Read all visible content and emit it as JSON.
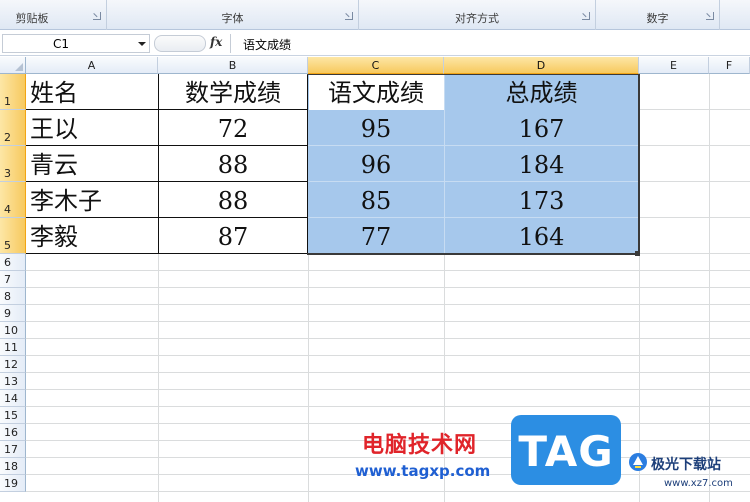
{
  "ribbon": {
    "groups": [
      {
        "label": "剪贴板"
      },
      {
        "label": "字体"
      },
      {
        "label": "对齐方式"
      },
      {
        "label": "数字"
      }
    ]
  },
  "formula_bar": {
    "name_box": "C1",
    "fx": "fx",
    "formula": "语文成绩"
  },
  "sheet": {
    "columns": [
      "A",
      "B",
      "C",
      "D",
      "E",
      "F"
    ],
    "rows": [
      "1",
      "2",
      "3",
      "4",
      "5",
      "6",
      "7",
      "8",
      "9",
      "10",
      "11",
      "12",
      "13",
      "14",
      "15",
      "16",
      "17",
      "18",
      "19"
    ],
    "selected_columns": [
      "C",
      "D"
    ],
    "selected_rows": [
      "1",
      "2",
      "3",
      "4",
      "5"
    ],
    "active_cell": "C1",
    "selection_color": "#a6c8ec",
    "table": {
      "headers": [
        "姓名",
        "数学成绩",
        "语文成绩",
        "总成绩"
      ],
      "rows": [
        [
          "王以",
          "72",
          "95",
          "167"
        ],
        [
          "青云",
          "88",
          "96",
          "184"
        ],
        [
          "李木子",
          "88",
          "85",
          "173"
        ],
        [
          "李毅",
          "87",
          "77",
          "164"
        ]
      ]
    }
  },
  "watermark": {
    "title": "电脑技术网",
    "url": "www.tagxp.com",
    "tag": "TAG",
    "site_name": "极光下载站",
    "site_url": "www.xz7.com"
  }
}
